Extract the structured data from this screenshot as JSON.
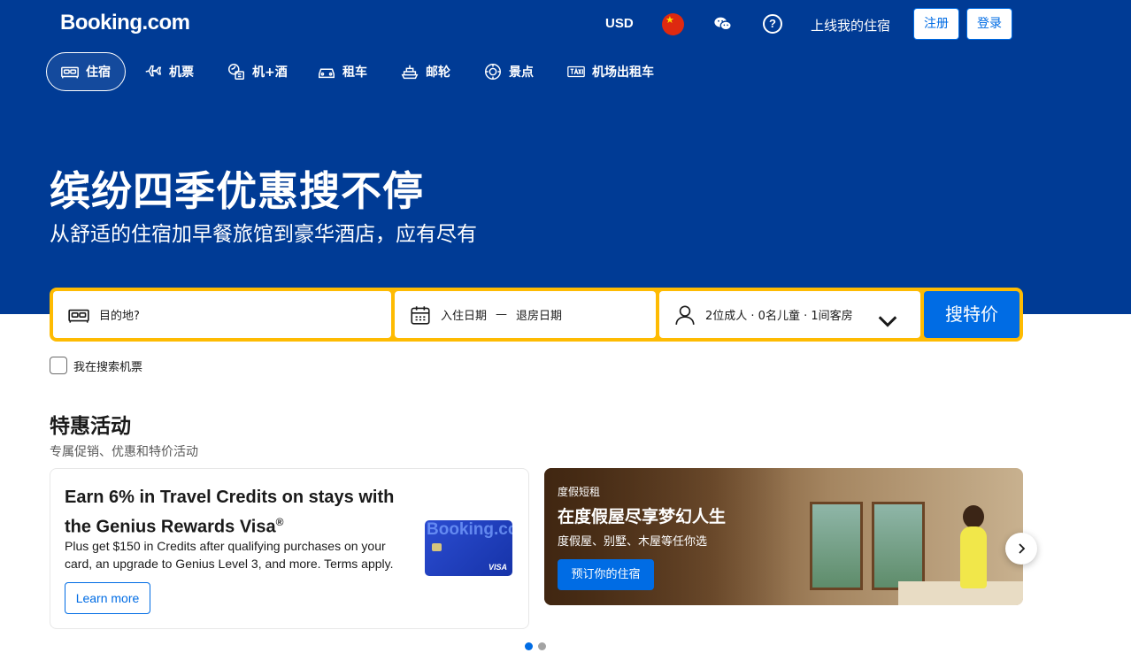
{
  "header": {
    "logo": "Booking.com",
    "currency": "USD",
    "flag_icon": "china-flag-icon",
    "list_property": "上线我的住宿",
    "register": "注册",
    "login": "登录"
  },
  "nav": {
    "items": [
      {
        "label": "住宿",
        "icon": "bed-icon",
        "active": true
      },
      {
        "label": "机票",
        "icon": "plane-icon",
        "active": false
      },
      {
        "label": "机+酒",
        "icon": "flight-hotel-icon",
        "active": false
      },
      {
        "label": "租车",
        "icon": "car-icon",
        "active": false
      },
      {
        "label": "邮轮",
        "icon": "ship-icon",
        "active": false
      },
      {
        "label": "景点",
        "icon": "attraction-icon",
        "active": false
      },
      {
        "label": "机场出租车",
        "icon": "taxi-icon",
        "active": false
      }
    ]
  },
  "hero": {
    "title": "缤纷四季优惠搜不停",
    "subtitle": "从舒适的住宿加早餐旅馆到豪华酒店，应有尽有"
  },
  "search": {
    "destination_placeholder": "目的地?",
    "checkin": "入住日期",
    "dash": "—",
    "checkout": "退房日期",
    "guests": "2位成人 · 0名儿童 · 1间客房",
    "button": "搜特价",
    "flights_checkbox": "我在搜索机票"
  },
  "offers": {
    "title": "特惠活动",
    "subtitle": "专属促销、优惠和特价活动",
    "card1": {
      "title": "Earn 6% in Travel Credits on stays with the Genius Rewards Visa",
      "title_mark": "®",
      "description": "Plus get $150 in Credits after qualifying purchases on your card, an upgrade to Genius Level 3, and more. Terms apply.",
      "button": "Learn more",
      "card_watermark": "Booking.com",
      "card_brand": "VISA"
    },
    "card2": {
      "eyebrow": "度假短租",
      "title": "在度假屋尽享梦幻人生",
      "subtitle": "度假屋、别墅、木屋等任你选",
      "button": "预订你的住宿"
    },
    "carousel_pages": 2,
    "carousel_active": 1
  },
  "colors": {
    "brand_blue": "#003b95",
    "action_blue": "#006ce4",
    "search_yellow": "#febb02"
  }
}
